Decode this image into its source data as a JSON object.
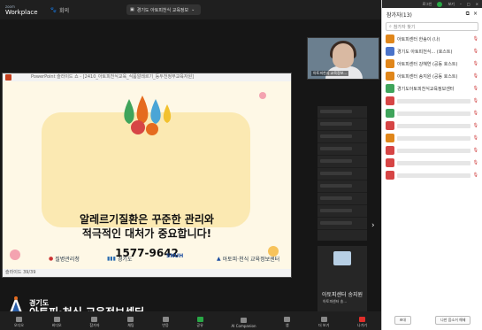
{
  "app": {
    "logo_top": "zoom",
    "logo_bottom": "Workplace",
    "home_label": "회의"
  },
  "meeting": {
    "title": "경기도 아토피천식 교육정보"
  },
  "window_controls": {
    "minimize": "로그인",
    "settings": "보기",
    "layout": "",
    "fullscreen": ""
  },
  "ppt": {
    "window_title": "PowerPoint 슬라이드 쇼 - [2410_아토피천식교육_식품알레르기_등두천정부교육자원]",
    "slide_line1": "알레르기질환은 꾸준한 관리와",
    "slide_line2": "적극적인 대처가 중요합니다!",
    "phone": "1577-9642",
    "logo1": "질병관리청",
    "logo2": "경기도",
    "logo3": "SNUH",
    "logo4": "아토피·천식 교육정보센터",
    "status": "슬라이드 39/39"
  },
  "video_tile": {
    "caption": "아토피천식 교육정보..."
  },
  "host_tile": {
    "name": "아토피센터 송지원",
    "sub": "아토피센터 송..."
  },
  "toolbar": [
    {
      "name": "audio",
      "label": "오디오"
    },
    {
      "name": "video",
      "label": "비디오"
    },
    {
      "name": "participants",
      "label": "참가자"
    },
    {
      "name": "chat",
      "label": "채팅"
    },
    {
      "name": "react",
      "label": "반응"
    },
    {
      "name": "share",
      "label": "공유"
    },
    {
      "name": "ai",
      "label": "AI Companion"
    },
    {
      "name": "apps",
      "label": "앱"
    },
    {
      "name": "more",
      "label": "더 보기"
    },
    {
      "name": "leave",
      "label": "나가기"
    }
  ],
  "watermark": {
    "small": "경기도",
    "big": "아토피·천식 교육정보센터"
  },
  "panel": {
    "top_items": [
      "로그인",
      "보기"
    ],
    "title": "참가자(13)",
    "search_placeholder": "참가자 찾기",
    "participants": [
      {
        "name": "아토피센터 한송이 (나)",
        "color": "#e0861a",
        "blurred": false
      },
      {
        "name": "경기도 아토피천식... (호스트)",
        "color": "#4a73c9",
        "blurred": false
      },
      {
        "name": "아토피센터 강혜연 (공동 호스트)",
        "color": "#e0861a",
        "blurred": false
      },
      {
        "name": "아토피센터 송지원 (공동 호스트)",
        "color": "#e0861a",
        "blurred": false
      },
      {
        "name": "경기도아토피천식교육정보센터",
        "color": "#3fa45b",
        "blurred": false
      },
      {
        "name": "참가자",
        "color": "#d64545",
        "blurred": true
      },
      {
        "name": "참가자",
        "color": "#3fa45b",
        "blurred": true
      },
      {
        "name": "참가자",
        "color": "#d64545",
        "blurred": true
      },
      {
        "name": "참가자",
        "color": "#e0861a",
        "blurred": true
      },
      {
        "name": "참가자",
        "color": "#d64545",
        "blurred": true
      },
      {
        "name": "참가자",
        "color": "#d64545",
        "blurred": true
      },
      {
        "name": "참가자",
        "color": "#d64545",
        "blurred": true
      }
    ],
    "invite_label": "초대",
    "mute_all_label": "나만 음소거 해제"
  }
}
